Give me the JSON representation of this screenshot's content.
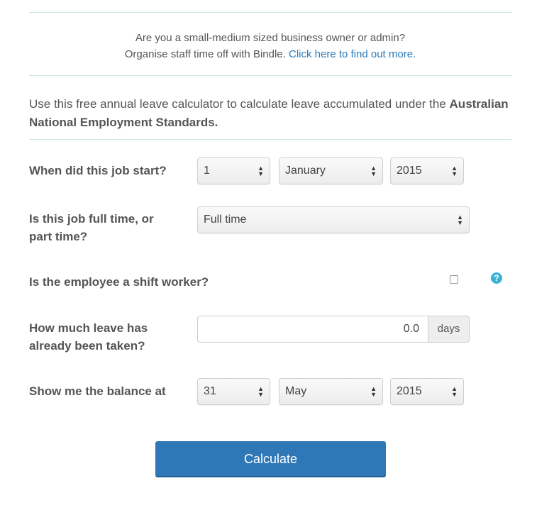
{
  "promo": {
    "line1": "Are you a small-medium sized business owner or admin?",
    "line2_prefix": "Organise staff time off with Bindle. ",
    "link": "Click here to find out more."
  },
  "intro": {
    "text": "Use this free annual leave calculator to calculate leave accumulated under the ",
    "bold": "Australian National Employment Standards."
  },
  "job_start": {
    "label": "When did this job start?",
    "day": "1",
    "month": "January",
    "year": "2015"
  },
  "job_type": {
    "label_line1": "Is this job full time, or",
    "label_line2": "part time?",
    "value": "Full time"
  },
  "shift_worker": {
    "label": "Is the employee a shift worker?",
    "checked": false,
    "help_icon": "question-circle-icon",
    "help_glyph": "?"
  },
  "leave_taken": {
    "label_line1": "How much leave has",
    "label_line2": "already been taken?",
    "value": "0.0",
    "unit": "days"
  },
  "balance_at": {
    "label": "Show me the balance at",
    "day": "31",
    "month": "May",
    "year": "2015"
  },
  "calculate_button": "Calculate",
  "colors": {
    "accent": "#2f78b7",
    "link": "#2a7ab8",
    "help": "#3bb3d9",
    "rule": "#cfe3e8"
  }
}
